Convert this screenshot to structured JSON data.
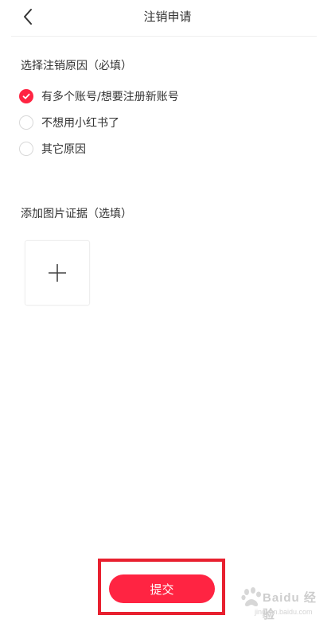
{
  "header": {
    "title": "注销申请",
    "back_icon": "chevron-left-icon"
  },
  "reasons": {
    "title": "选择注销原因（必填）",
    "options": [
      {
        "label": "有多个账号/想要注册新账号",
        "checked": true
      },
      {
        "label": "不想用小红书了",
        "checked": false
      },
      {
        "label": "其它原因",
        "checked": false
      }
    ]
  },
  "photo": {
    "title": "添加图片证据（选填）",
    "add_icon": "plus-icon"
  },
  "submit": {
    "label": "提交"
  },
  "watermark": {
    "brand": "Baidu 经验",
    "url": "jingyan.baidu.com"
  },
  "colors": {
    "accent": "#ff2442",
    "highlight_border": "#e8202f",
    "text": "#333333",
    "divider": "#eeeeee"
  }
}
